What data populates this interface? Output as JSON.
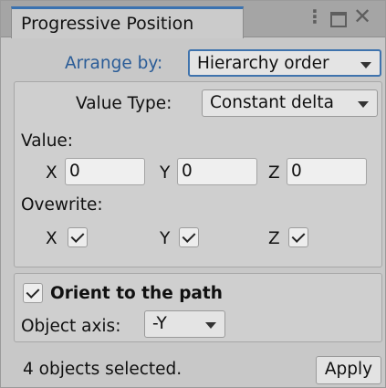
{
  "window": {
    "tab_title": "Progressive Position",
    "icons": [
      "kebab-menu-icon",
      "maximize-icon",
      "close-icon"
    ]
  },
  "arrange": {
    "label": "Arrange by:",
    "selected": "Hierarchy order"
  },
  "value_section": {
    "value_type_label": "Value Type:",
    "value_type_selected": "Constant delta",
    "value_label": "Value:",
    "x_label": "X",
    "x_value": "0",
    "y_label": "Y",
    "y_value": "0",
    "z_label": "Z",
    "z_value": "0",
    "overwrite_label": "Ovewrite:",
    "overwrite": {
      "x_label": "X",
      "x_checked": true,
      "y_label": "Y",
      "y_checked": true,
      "z_label": "Z",
      "z_checked": true
    }
  },
  "orient_section": {
    "orient_label": "Orient to the path",
    "orient_checked": true,
    "object_axis_label": "Object axis:",
    "object_axis_selected": "-Y"
  },
  "footer": {
    "status": "4 objects selected.",
    "apply_label": "Apply"
  },
  "colors": {
    "accent": "#3a72b0",
    "link_label": "#2a5c97",
    "panel_bg": "#c8c8c8"
  }
}
